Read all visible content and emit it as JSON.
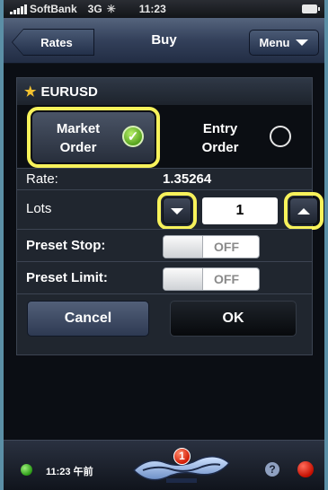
{
  "status_bar": {
    "carrier": "SoftBank",
    "network": "3G",
    "time": "11:23"
  },
  "nav": {
    "back_label": "Rates",
    "title": "Buy",
    "menu_label": "Menu"
  },
  "order": {
    "symbol": "EURUSD",
    "market_order": {
      "line1": "Market",
      "line2": "Order",
      "selected": true
    },
    "entry_order": {
      "line1": "Entry",
      "line2": "Order",
      "selected": false
    },
    "rate_label": "Rate:",
    "rate_value": "1.35264",
    "lots_label": "Lots",
    "lots_value": "1",
    "preset_stop_label": "Preset Stop:",
    "preset_stop_state": "OFF",
    "preset_limit_label": "Preset Limit:",
    "preset_limit_state": "OFF",
    "cancel_label": "Cancel",
    "ok_label": "OK"
  },
  "bottom_bar": {
    "time": "11:23 午前",
    "badge_count": "1",
    "help_icon": "?"
  },
  "colors": {
    "highlight": "#f7f25b",
    "star": "#f2c230",
    "check": "#55a21e"
  }
}
